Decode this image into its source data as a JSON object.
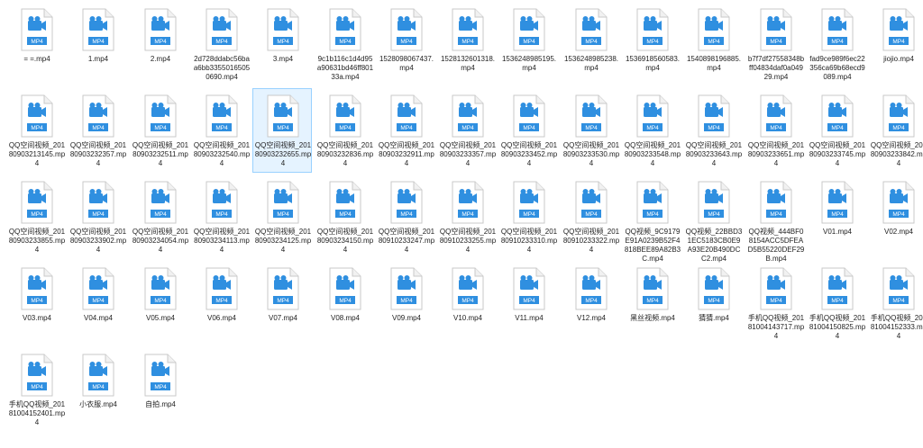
{
  "files": [
    {
      "name": "= =.mp4"
    },
    {
      "name": "1.mp4"
    },
    {
      "name": "2.mp4"
    },
    {
      "name": "2d728ddabc56baa6bb33550165050690.mp4"
    },
    {
      "name": "3.mp4"
    },
    {
      "name": "9c1b116c1d4d95a90631bd46ff80133a.mp4"
    },
    {
      "name": "1528098067437.mp4"
    },
    {
      "name": "1528132601318.mp4"
    },
    {
      "name": "1536248985195.mp4"
    },
    {
      "name": "1536248985238.mp4"
    },
    {
      "name": "1536918560583.mp4"
    },
    {
      "name": "1540898196885.mp4"
    },
    {
      "name": "b7f7df27558348bff04834daf0a04929.mp4"
    },
    {
      "name": "fad9ce989f6ec22356ca69b68ecd9089.mp4"
    },
    {
      "name": "jiojio.mp4"
    },
    {
      "name": "QQ空间视频_20180903213145.mp4"
    },
    {
      "name": "QQ空间视频_20180903232357.mp4"
    },
    {
      "name": "QQ空间视频_20180903232511.mp4"
    },
    {
      "name": "QQ空间视频_20180903232540.mp4"
    },
    {
      "name": "QQ空间视频_20180903232655.mp4"
    },
    {
      "name": "QQ空间视频_20180903232836.mp4"
    },
    {
      "name": "QQ空间视频_20180903232911.mp4"
    },
    {
      "name": "QQ空间视频_20180903233357.mp4"
    },
    {
      "name": "QQ空间视频_20180903233452.mp4"
    },
    {
      "name": "QQ空间视频_20180903233530.mp4"
    },
    {
      "name": "QQ空间视频_20180903233548.mp4"
    },
    {
      "name": "QQ空间视频_20180903233643.mp4"
    },
    {
      "name": "QQ空间视频_20180903233651.mp4"
    },
    {
      "name": "QQ空间视频_20180903233745.mp4"
    },
    {
      "name": "QQ空间视频_20180903233842.mp4"
    },
    {
      "name": "QQ空间视频_20180903233855.mp4"
    },
    {
      "name": "QQ空间视频_20180903233902.mp4"
    },
    {
      "name": "QQ空间视频_20180903234054.mp4"
    },
    {
      "name": "QQ空间视频_20180903234113.mp4"
    },
    {
      "name": "QQ空间视频_20180903234125.mp4"
    },
    {
      "name": "QQ空间视频_20180903234150.mp4"
    },
    {
      "name": "QQ空间视频_20180910233247.mp4"
    },
    {
      "name": "QQ空间视频_20180910233255.mp4"
    },
    {
      "name": "QQ空间视频_20180910233310.mp4"
    },
    {
      "name": "QQ空间视频_20180910233322.mp4"
    },
    {
      "name": "QQ视频_9C9179E91A0239B52F4818BEE89A82B3C.mp4"
    },
    {
      "name": "QQ视频_22BBD31EC5183CB0E9A93E20B490DCC2.mp4"
    },
    {
      "name": "QQ视频_444BF08154ACC5DFEAD5B55220DEF29B.mp4"
    },
    {
      "name": "V01.mp4"
    },
    {
      "name": "V02.mp4"
    },
    {
      "name": "V03.mp4"
    },
    {
      "name": "V04.mp4"
    },
    {
      "name": "V05.mp4"
    },
    {
      "name": "V06.mp4"
    },
    {
      "name": "V07.mp4"
    },
    {
      "name": "V08.mp4"
    },
    {
      "name": "V09.mp4"
    },
    {
      "name": "V10.mp4"
    },
    {
      "name": "V11.mp4"
    },
    {
      "name": "V12.mp4"
    },
    {
      "name": "黑丝视频.mp4"
    },
    {
      "name": "猜猜.mp4"
    },
    {
      "name": "手机QQ视频_20181004143717.mp4"
    },
    {
      "name": "手机QQ视频_20181004150825.mp4"
    },
    {
      "name": "手机QQ视频_20181004152333.mp4"
    },
    {
      "name": "手机QQ视频_20181004152401.mp4"
    },
    {
      "name": "小衣服.mp4"
    },
    {
      "name": "自拍.mp4"
    }
  ],
  "selected_index": 19,
  "icon": {
    "name": "mp4-video-file-icon",
    "badge": "MP4",
    "accent": "#2f8fe0"
  }
}
